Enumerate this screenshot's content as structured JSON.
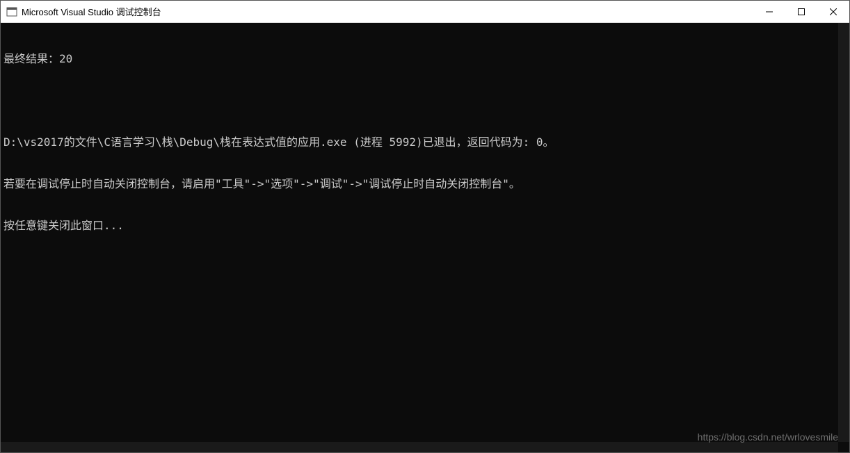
{
  "titleBar": {
    "title": "Microsoft Visual Studio 调试控制台",
    "icon": "console-icon"
  },
  "winControls": {
    "minimize": "—",
    "maximize": "◻",
    "close": "✕"
  },
  "console": {
    "lines": [
      "最终结果：20",
      "",
      "D:\\vs2017的文件\\C语言学习\\栈\\Debug\\栈在表达式值的应用.exe (进程 5992)已退出，返回代码为: 0。",
      "若要在调试停止时自动关闭控制台，请启用\"工具\"->\"选项\"->\"调试\"->\"调试停止时自动关闭控制台\"。",
      "按任意键关闭此窗口..."
    ]
  },
  "watermark": "https://blog.csdn.net/wrlovesmile"
}
